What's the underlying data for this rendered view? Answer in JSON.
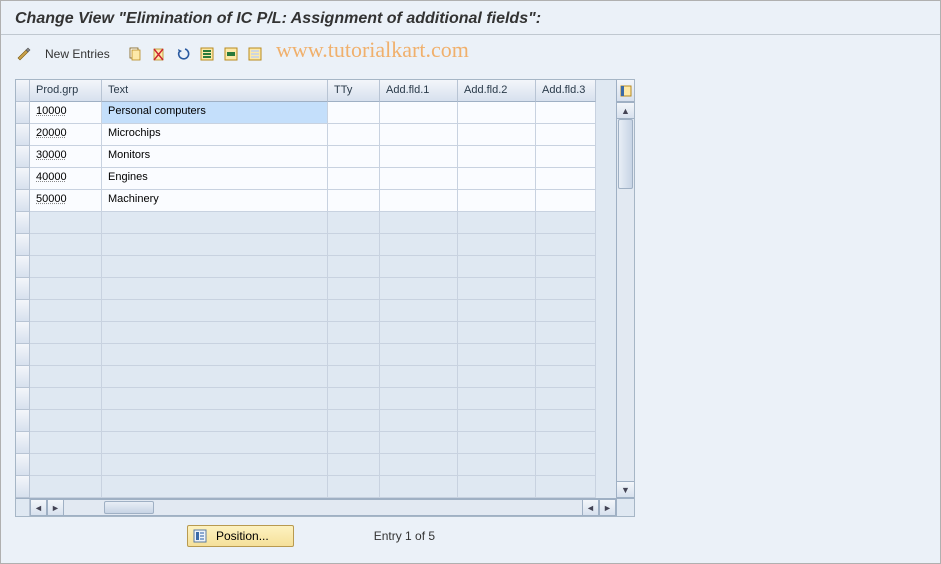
{
  "title": "Change View \"Elimination of IC P/L: Assignment of additional fields\":",
  "toolbar": {
    "new_entries": "New Entries"
  },
  "watermark": "www.tutorialkart.com",
  "columns": {
    "prodgrp": "Prod.grp",
    "text": "Text",
    "tty": "TTy",
    "af1": "Add.fld.1",
    "af2": "Add.fld.2",
    "af3": "Add.fld.3"
  },
  "rows": [
    {
      "prodgrp": "10000",
      "text": "Personal computers",
      "tty": "",
      "af1": "",
      "af2": "",
      "af3": ""
    },
    {
      "prodgrp": "20000",
      "text": "Microchips",
      "tty": "",
      "af1": "",
      "af2": "",
      "af3": ""
    },
    {
      "prodgrp": "30000",
      "text": "Monitors",
      "tty": "",
      "af1": "",
      "af2": "",
      "af3": ""
    },
    {
      "prodgrp": "40000",
      "text": "Engines",
      "tty": "",
      "af1": "",
      "af2": "",
      "af3": ""
    },
    {
      "prodgrp": "50000",
      "text": "Machinery",
      "tty": "",
      "af1": "",
      "af2": "",
      "af3": ""
    }
  ],
  "empty_row_count": 13,
  "footer": {
    "position_label": "Position...",
    "entry_text": "Entry 1 of 5"
  },
  "colors": {
    "accent": "#fdf2c0",
    "header_bg": "#ebf1f8"
  }
}
